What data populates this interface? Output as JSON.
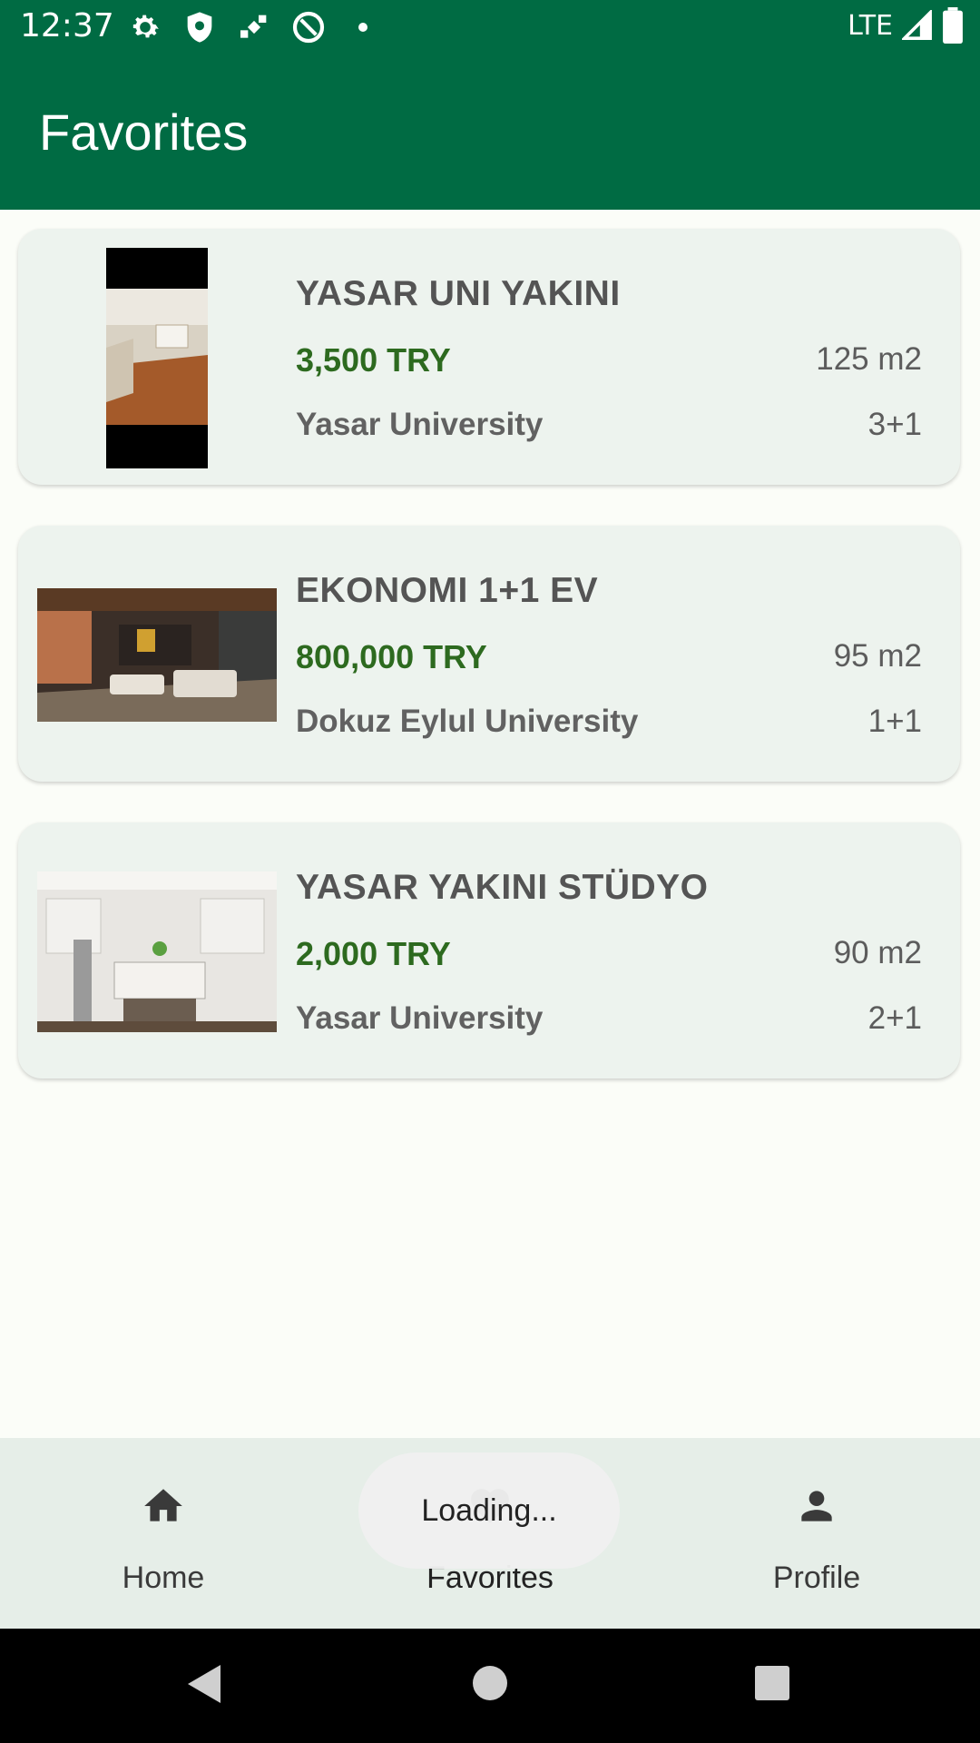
{
  "status_bar": {
    "time": "12:37",
    "network": "LTE",
    "icons": [
      "gear-icon",
      "shield-icon",
      "satellite-icon",
      "at-sign-icon",
      "dot-icon",
      "signal-icon",
      "battery-icon"
    ]
  },
  "app_bar": {
    "title": "Favorites"
  },
  "listings": [
    {
      "title": "YASAR UNI YAKINI",
      "price": "3,500 TRY",
      "area": "125 m2",
      "university": "Yasar University",
      "rooms": "3+1"
    },
    {
      "title": "EKONOMI 1+1 EV",
      "price": "800,000 TRY",
      "area": "95 m2",
      "university": "Dokuz Eylul University",
      "rooms": "1+1"
    },
    {
      "title": "YASAR YAKINI STÜDYO",
      "price": "2,000 TRY",
      "area": "90 m2",
      "university": "Yasar University",
      "rooms": "2+1"
    }
  ],
  "bottom_nav": {
    "items": [
      {
        "label": "Home",
        "icon": "home-icon"
      },
      {
        "label": "Favorites",
        "icon": "heart-icon",
        "selected": true
      },
      {
        "label": "Profile",
        "icon": "person-icon"
      }
    ]
  },
  "toast": {
    "text": "Loading..."
  },
  "colors": {
    "primary": "#006b43",
    "price": "#2d6a1f",
    "card_bg": "#edf3ee"
  }
}
